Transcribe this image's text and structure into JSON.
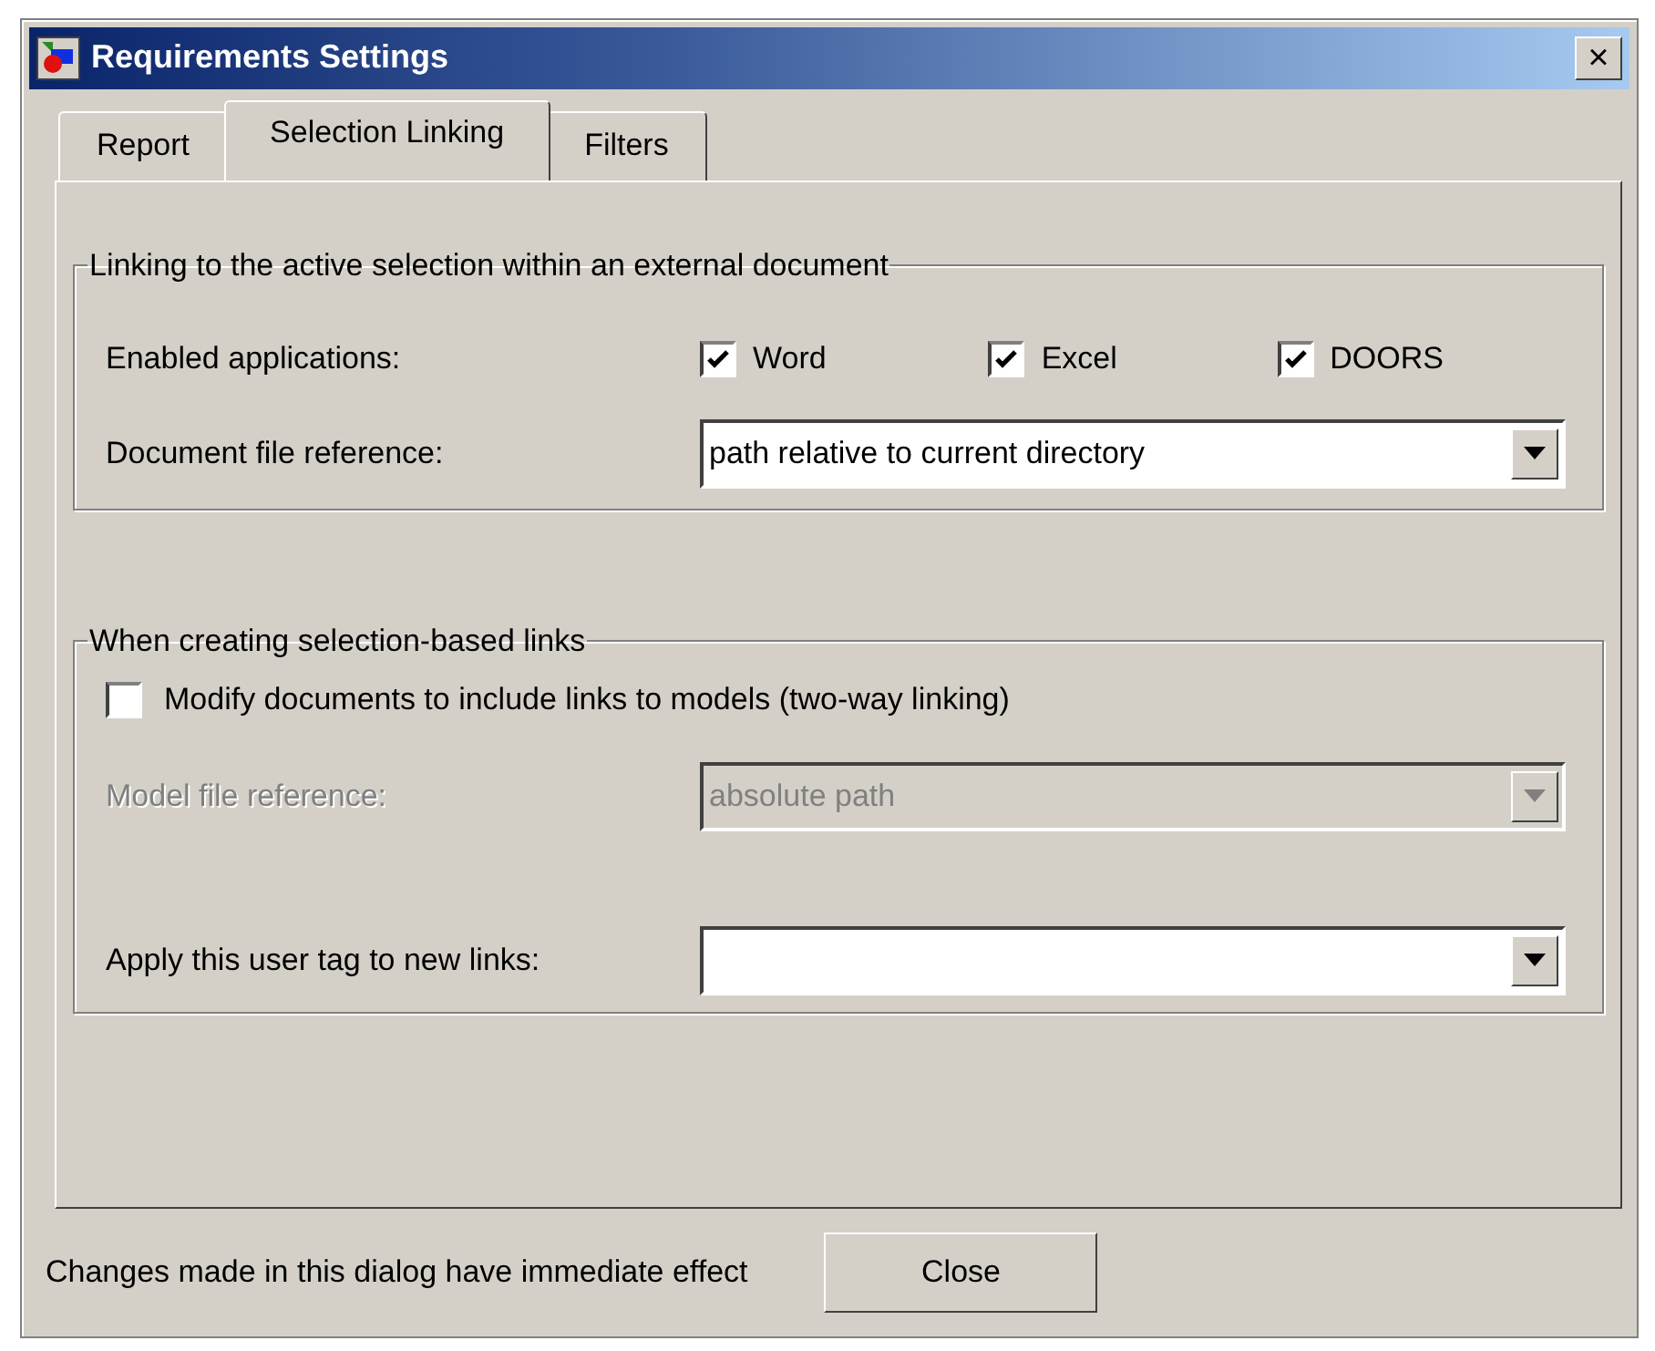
{
  "window": {
    "title": "Requirements Settings",
    "close": "×"
  },
  "tabs": [
    {
      "label": "Report",
      "selected": false
    },
    {
      "label": "Selection Linking",
      "selected": true
    },
    {
      "label": "Filters",
      "selected": false
    }
  ],
  "groups": [
    {
      "legend": "Linking to the active selection within an external document",
      "rows": [
        {
          "kind": "checkboxes",
          "label": "Enabled applications:",
          "options": [
            {
              "label": "Word",
              "checked": true
            },
            {
              "label": "Excel",
              "checked": true
            },
            {
              "label": "DOORS",
              "checked": true
            }
          ]
        },
        {
          "kind": "dropdown",
          "label": "Document file reference:",
          "value": "path relative to current directory",
          "disabled": false
        }
      ]
    },
    {
      "legend": "When creating selection-based links",
      "rows": [
        {
          "kind": "checkbox",
          "label": "Modify documents to include links to models (two-way linking)",
          "checked": false
        },
        {
          "kind": "dropdown",
          "label": "Model file reference:",
          "value": "absolute path",
          "disabled": true
        },
        {
          "kind": "dropdown",
          "label": "Apply this user tag to new links:",
          "disabled": false
        }
      ]
    }
  ],
  "footer": {
    "note": "Changes made in this dialog have immediate effect",
    "button": "Close"
  }
}
